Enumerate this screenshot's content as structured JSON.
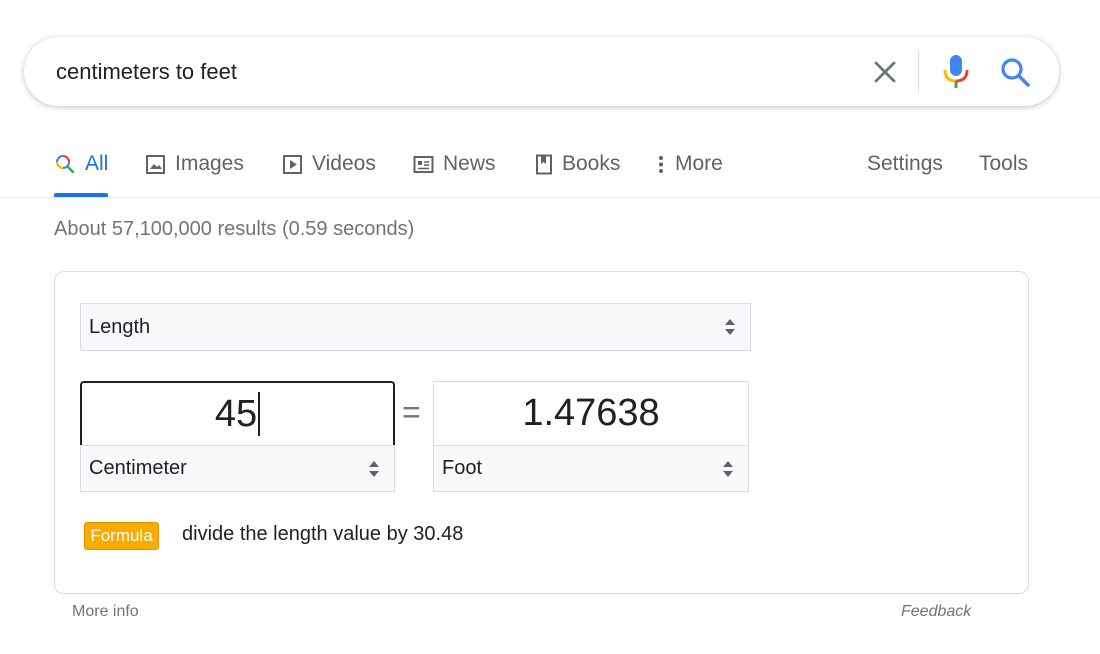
{
  "search": {
    "query": "centimeters to feet"
  },
  "tabs": {
    "items": [
      {
        "label": "All",
        "icon": "search-icon",
        "active": true
      },
      {
        "label": "Images",
        "icon": "image-icon"
      },
      {
        "label": "Videos",
        "icon": "play-icon"
      },
      {
        "label": "News",
        "icon": "newspaper-icon"
      },
      {
        "label": "Books",
        "icon": "book-icon"
      },
      {
        "label": "More",
        "icon": "more-vert-icon"
      }
    ],
    "settings": "Settings",
    "tools": "Tools"
  },
  "results_stats": "About 57,100,000 results (0.59 seconds)",
  "converter": {
    "measure": "Length",
    "from_value": "45",
    "to_value": "1.47638",
    "equals": "=",
    "from_unit": "Centimeter",
    "to_unit": "Foot",
    "formula_label": "Formula",
    "formula_text": "divide the length value by 30.48"
  },
  "footer": {
    "more_info": "More info",
    "feedback": "Feedback"
  },
  "colors": {
    "accent": "#1a73e8",
    "formula_badge": "#f9ab00",
    "mic_blue": "#4285f4",
    "mic_red": "#ea4335",
    "mic_yellow": "#fbbc04",
    "mic_green": "#34a853"
  }
}
